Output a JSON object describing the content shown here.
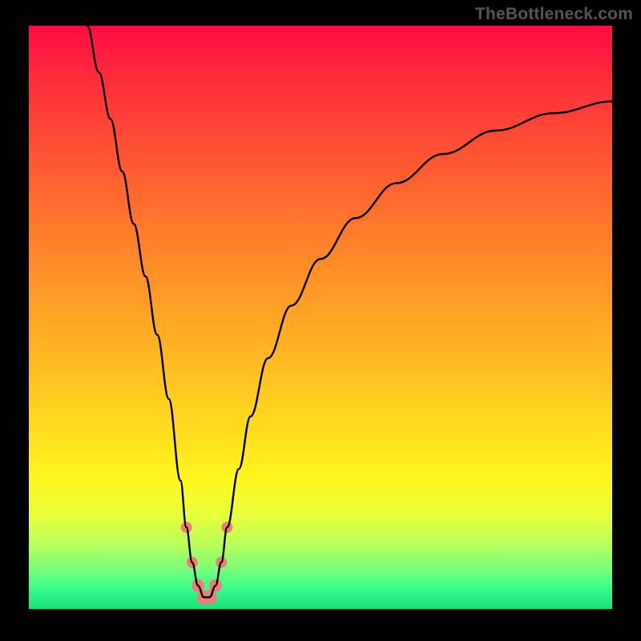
{
  "watermark": "TheBottleneck.com",
  "chart_data": {
    "type": "line",
    "title": "",
    "xlabel": "",
    "ylabel": "",
    "xlim": [
      0,
      100
    ],
    "ylim": [
      0,
      100
    ],
    "grid": false,
    "legend": false,
    "background_gradient": {
      "orientation": "vertical",
      "stops": [
        {
          "pos": 0.0,
          "color": "#ff0b43"
        },
        {
          "pos": 0.18,
          "color": "#ff4736"
        },
        {
          "pos": 0.42,
          "color": "#ff8f28"
        },
        {
          "pos": 0.68,
          "color": "#ffd91f"
        },
        {
          "pos": 0.84,
          "color": "#e8ff3a"
        },
        {
          "pos": 0.96,
          "color": "#3fff8c"
        },
        {
          "pos": 1.0,
          "color": "#17e27a"
        }
      ]
    },
    "series": [
      {
        "name": "bottleneck-curve",
        "x": [
          10,
          12,
          14,
          16,
          18,
          20,
          22,
          24,
          26,
          27,
          28,
          29,
          30,
          31,
          32,
          33,
          34,
          36,
          38,
          41,
          45,
          50,
          56,
          63,
          71,
          80,
          90,
          100
        ],
        "y": [
          100,
          92,
          84,
          75,
          66,
          57,
          47,
          36,
          22,
          14,
          8,
          4,
          2,
          2,
          4,
          8,
          14,
          24,
          33,
          43,
          52,
          60,
          67,
          73,
          78,
          82,
          85,
          87
        ]
      }
    ],
    "markers": {
      "name": "highlight-dots",
      "color": "#ee7d77",
      "x": [
        27,
        28,
        29,
        30,
        31,
        32,
        33,
        34
      ],
      "y": [
        14,
        8,
        4,
        2,
        2,
        4,
        8,
        14
      ],
      "r": [
        7,
        7,
        8,
        9,
        9,
        8,
        7,
        7
      ]
    }
  }
}
